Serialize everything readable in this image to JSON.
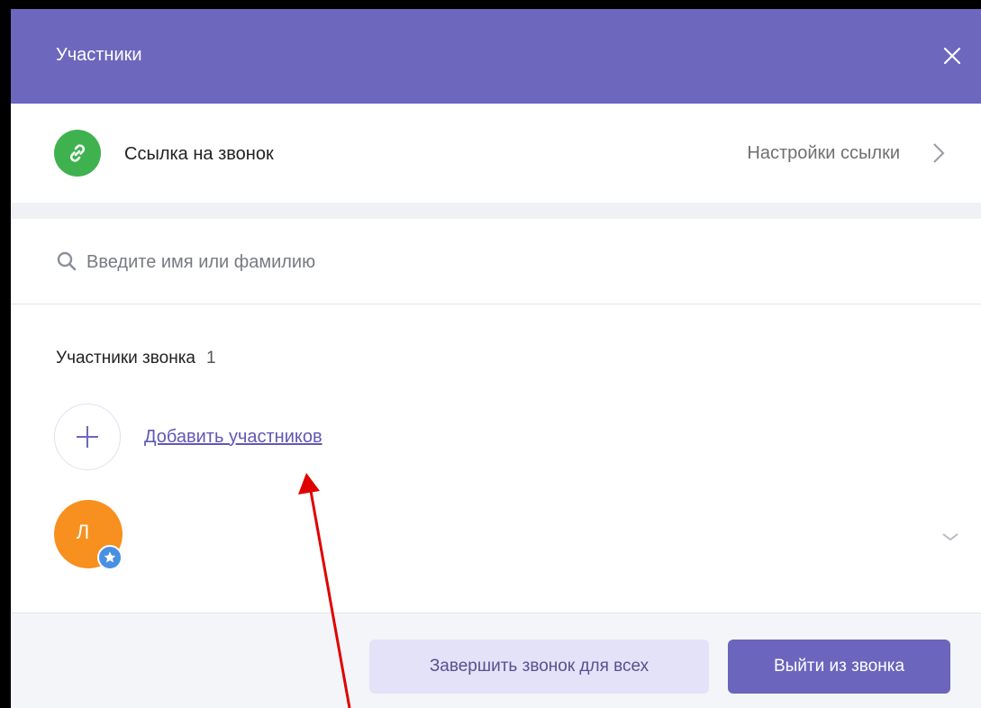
{
  "header": {
    "title": "Участники",
    "close_icon": "close-icon"
  },
  "call_link": {
    "label": "Ссылка на звонок",
    "settings_label": "Настройки ссылки",
    "icon": "link-icon",
    "icon_color": "#3fb24f"
  },
  "search": {
    "placeholder": "Введите имя или фамилию",
    "value": ""
  },
  "participants": {
    "title": "Участники звонка",
    "count": "1",
    "add_label": "Добавить участников",
    "items": [
      {
        "initial": "Л",
        "avatar_color": "#f7901e",
        "badge": "star-icon"
      }
    ]
  },
  "footer": {
    "end_for_all_label": "Завершить звонок для всех",
    "leave_label": "Выйти из звонка"
  },
  "colors": {
    "accent": "#6d67be",
    "annotation_arrow": "#e00000"
  }
}
